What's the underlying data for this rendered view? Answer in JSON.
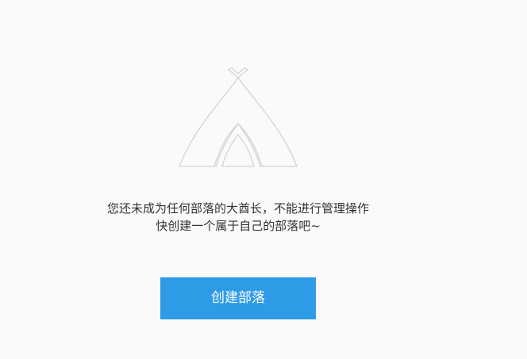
{
  "empty_state": {
    "icon": "tent-icon",
    "message_line1": "您还未成为任何部落的大酋长，不能进行管理操作",
    "message_line2": "快创建一个属于自己的部落吧~",
    "create_button_label": "创建部落"
  },
  "colors": {
    "background": "#fafafa",
    "icon_stroke": "#d4d4d4",
    "text": "#333333",
    "button": "#2e9be6",
    "button_text": "#ffffff"
  }
}
